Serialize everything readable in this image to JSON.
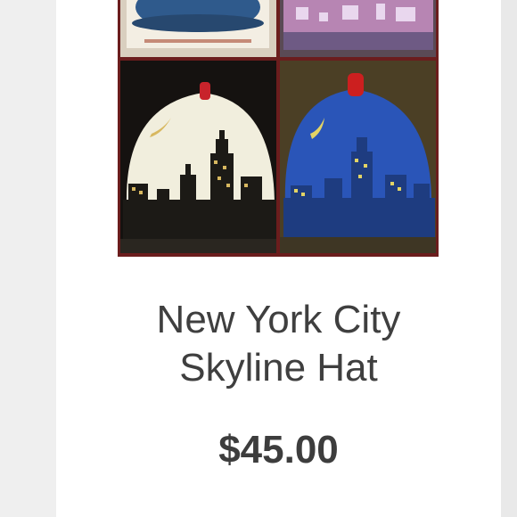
{
  "product": {
    "title_line1": "New York City",
    "title_line2": "Skyline Hat",
    "price": "$45.00"
  },
  "colors": {
    "page_bg": "#efefef",
    "card_bg": "#ffffff",
    "text": "#3f3f3f",
    "image_border": "#6b1d1d"
  }
}
